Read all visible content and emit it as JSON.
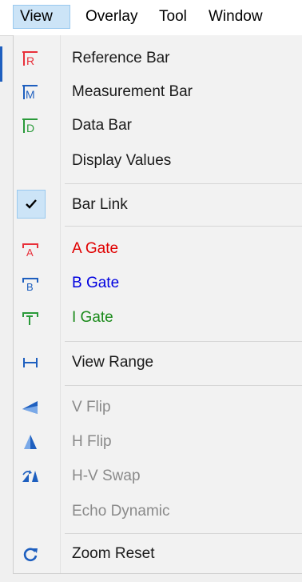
{
  "menubar": {
    "items": [
      "View",
      "Overlay",
      "Tool",
      "Window"
    ]
  },
  "menu": {
    "items": [
      {
        "label": "Reference Bar",
        "icon": "reference-bar-icon",
        "color": "#1a1a1a"
      },
      {
        "label": "Measurement Bar",
        "icon": "measurement-bar-icon",
        "color": "#1a1a1a"
      },
      {
        "label": "Data Bar",
        "icon": "data-bar-icon",
        "color": "#1a1a1a"
      },
      {
        "label": "Display Values",
        "icon": "",
        "color": "#1a1a1a"
      },
      {
        "label": "Bar Link",
        "icon": "check-icon",
        "checked": true,
        "color": "#1a1a1a"
      },
      {
        "label": "A Gate",
        "icon": "a-gate-icon",
        "color": "#e00000"
      },
      {
        "label": "B Gate",
        "icon": "b-gate-icon",
        "color": "#0000e0"
      },
      {
        "label": "I Gate",
        "icon": "i-gate-icon",
        "color": "#1a8a1a"
      },
      {
        "label": "View Range",
        "icon": "view-range-icon",
        "color": "#1a1a1a"
      },
      {
        "label": "V Flip",
        "icon": "v-flip-icon",
        "disabled": true
      },
      {
        "label": "H Flip",
        "icon": "h-flip-icon",
        "disabled": true
      },
      {
        "label": "H-V Swap",
        "icon": "hv-swap-icon",
        "disabled": true
      },
      {
        "label": "Echo Dynamic",
        "icon": "",
        "disabled": true
      },
      {
        "label": "Zoom Reset",
        "icon": "zoom-reset-icon",
        "color": "#1a1a1a"
      }
    ]
  },
  "colors": {
    "red": "#e8303a",
    "blue": "#1e5fbf",
    "green": "#2a9a3a",
    "accent": "#cce4f7"
  }
}
